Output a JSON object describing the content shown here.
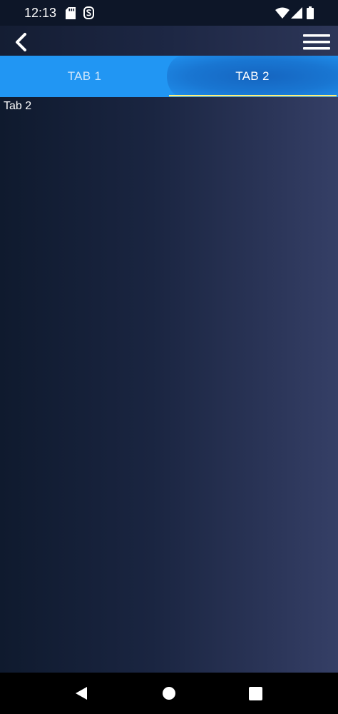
{
  "status_bar": {
    "time": "12:13",
    "icons": [
      "sd-card-icon",
      "s-app-icon",
      "wifi-icon",
      "cell-signal-icon",
      "battery-icon"
    ]
  },
  "app_bar": {
    "back_icon": "chevron-left-icon",
    "menu_icon": "hamburger-menu-icon"
  },
  "tabs": [
    {
      "label": "TAB 1",
      "selected": false
    },
    {
      "label": "TAB 2",
      "selected": true
    }
  ],
  "content": {
    "text": "Tab 2"
  },
  "colors": {
    "tab_bar": "#2196f3",
    "selected_tab": "#1976d2",
    "indicator": "#fff176",
    "background_start": "#0f1a2e",
    "background_end": "#353f66"
  },
  "nav_bar": {
    "icons": [
      "nav-back-icon",
      "nav-home-icon",
      "nav-recents-icon"
    ]
  }
}
